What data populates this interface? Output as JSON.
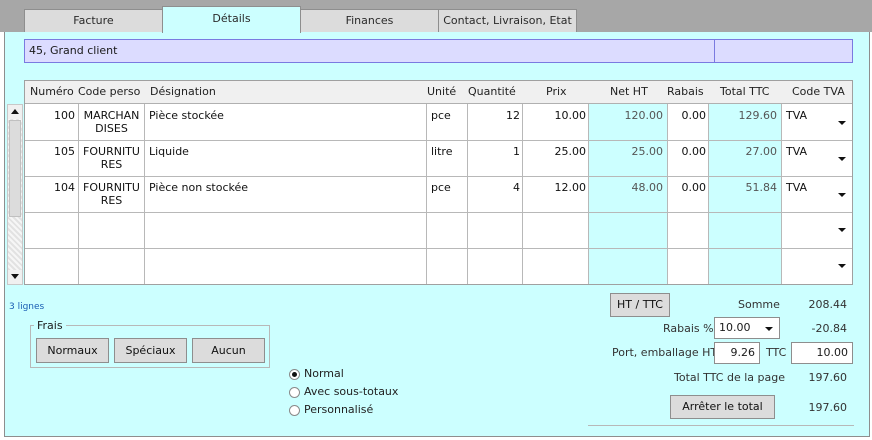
{
  "tabs": [
    {
      "label": "Facture"
    },
    {
      "label": "Détails"
    },
    {
      "label": "Finances"
    },
    {
      "label": "Contact, Livraison, Etat"
    }
  ],
  "client": {
    "name": "45, Grand client"
  },
  "table": {
    "columns": [
      "Numéro",
      "Code perso",
      "Désignation",
      "Unité",
      "Quantité",
      "Prix",
      "Net HT",
      "Rabais",
      "Total TTC",
      "Code TVA"
    ],
    "rows": [
      {
        "numero": "100",
        "code_perso": "MARCHANDISES",
        "code_a": "MARCHAN",
        "code_b": "DISES",
        "designation": "Pièce stockée",
        "unite": "pce",
        "quantite": "12",
        "prix": "10.00",
        "net_ht": "120.00",
        "rabais": "0.00",
        "total_ttc": "129.60",
        "code_tva": "TVA"
      },
      {
        "numero": "105",
        "code_perso": "FOURNITURES",
        "code_a": "FOURNITU",
        "code_b": "RES",
        "designation": "Liquide",
        "unite": "litre",
        "quantite": "1",
        "prix": "25.00",
        "net_ht": "25.00",
        "rabais": "0.00",
        "total_ttc": "27.00",
        "code_tva": "TVA"
      },
      {
        "numero": "104",
        "code_perso": "FOURNITURES",
        "code_a": "FOURNITU",
        "code_b": "RES",
        "designation": "Pièce non stockée",
        "unite": "pce",
        "quantite": "4",
        "prix": "12.00",
        "net_ht": "48.00",
        "rabais": "0.00",
        "total_ttc": "51.84",
        "code_tva": "TVA"
      }
    ],
    "line_count": "3 lignes"
  },
  "frais": {
    "legend": "Frais",
    "buttons": [
      "Normaux",
      "Spéciaux",
      "Aucun"
    ]
  },
  "display_mode": {
    "options": [
      "Normal",
      "Avec sous-totaux",
      "Personnalisé"
    ],
    "selected": "Normal"
  },
  "totals": {
    "ht_ttc_button": "HT / TTC",
    "somme_label": "Somme",
    "somme_value": "208.44",
    "rabais_label": "Rabais %",
    "rabais_percent": "10.00",
    "rabais_value": "-20.84",
    "port_label": "Port, emballage HT",
    "port_ht": "9.26",
    "ttc_label": "TTC",
    "port_ttc": "10.00",
    "total_page_label": "Total TTC de la page",
    "total_page_value": "197.60",
    "stop_total_button": "Arrêter le total",
    "stop_total_value": "197.60"
  },
  "colors": {
    "panel_bg": "#ccffff",
    "client_bg": "#dcdcff",
    "tab_bar": "#a7a7a7"
  },
  "icons": {
    "dropdown": "chevron-down-icon",
    "scroll_up": "arrow-up-icon",
    "scroll_down": "arrow-down-icon"
  }
}
